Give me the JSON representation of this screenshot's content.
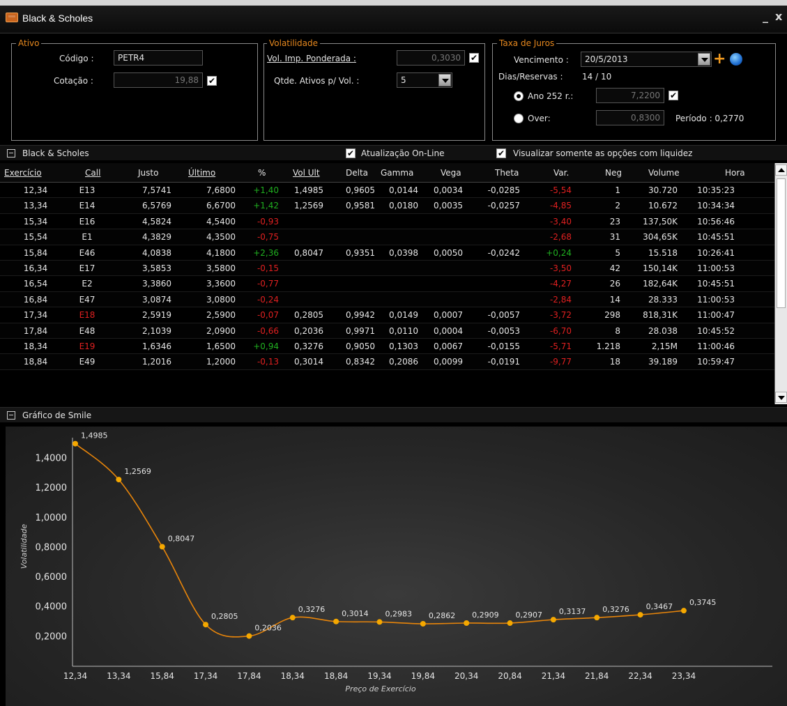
{
  "window": {
    "title": "Black & Scholes",
    "minimize": "_",
    "close": "x"
  },
  "ativo": {
    "legend": "Ativo",
    "codigo_label": "Código :",
    "codigo_value": "PETR4",
    "cotacao_label": "Cotação :",
    "cotacao_value": "19,88",
    "cotacao_checked": true
  },
  "volatilidade": {
    "legend": "Volatilidade",
    "vol_imp_label": "Vol. Imp. Ponderada :",
    "vol_imp_value": "0,3030",
    "vol_imp_checked": true,
    "qtde_label": "Qtde. Ativos p/ Vol. :",
    "qtde_value": "5"
  },
  "juros": {
    "legend": "Taxa de Juros",
    "vencimento_label": "Vencimento :",
    "vencimento_value": "20/5/2013",
    "dias_label": "Dias/Reservas :",
    "dias_value": "14 / 10",
    "ano_label": "Ano 252 r.:",
    "ano_value": "7,2200",
    "ano_checked": true,
    "over_label": "Over:",
    "over_value": "0,8300",
    "periodo_label": "Período : 0,2770"
  },
  "bs_section": {
    "title": "Black & Scholes",
    "online_label": "Atualização On-Line",
    "liquidez_label": "Visualizar somente as opções com liquidez"
  },
  "table": {
    "headers": [
      "Exercício",
      "Call",
      "Justo",
      "Último",
      "%",
      "Vol Ult",
      "Delta",
      "Gamma",
      "Vega",
      "Theta",
      "Var.",
      "Neg",
      "Volume",
      "Hora"
    ],
    "rows": [
      [
        "12,34",
        "E13",
        "7,5741",
        "7,6800",
        "+1,40",
        "1,4985",
        "0,9605",
        "0,0144",
        "0,0034",
        "-0,0285",
        "-5,54",
        "1",
        "30.720",
        "10:35:23"
      ],
      [
        "13,34",
        "E14",
        "6,5769",
        "6,6700",
        "+1,42",
        "1,2569",
        "0,9581",
        "0,0180",
        "0,0035",
        "-0,0257",
        "-4,85",
        "2",
        "10.672",
        "10:34:34"
      ],
      [
        "15,34",
        "E16",
        "4,5824",
        "4,5400",
        "-0,93",
        "",
        "",
        "",
        "",
        "",
        "-3,40",
        "23",
        "137,50K",
        "10:56:46"
      ],
      [
        "15,54",
        "E1",
        "4,3829",
        "4,3500",
        "-0,75",
        "",
        "",
        "",
        "",
        "",
        "-2,68",
        "31",
        "304,65K",
        "10:45:51"
      ],
      [
        "15,84",
        "E46",
        "4,0838",
        "4,1800",
        "+2,36",
        "0,8047",
        "0,9351",
        "0,0398",
        "0,0050",
        "-0,0242",
        "+0,24",
        "5",
        "15.518",
        "10:26:41"
      ],
      [
        "16,34",
        "E17",
        "3,5853",
        "3,5800",
        "-0,15",
        "",
        "",
        "",
        "",
        "",
        "-3,50",
        "42",
        "150,14K",
        "11:00:53"
      ],
      [
        "16,54",
        "E2",
        "3,3860",
        "3,3600",
        "-0,77",
        "",
        "",
        "",
        "",
        "",
        "-4,27",
        "26",
        "182,64K",
        "10:45:51"
      ],
      [
        "16,84",
        "E47",
        "3,0874",
        "3,0800",
        "-0,24",
        "",
        "",
        "",
        "",
        "",
        "-2,84",
        "14",
        "28.333",
        "11:00:53"
      ],
      [
        "17,34",
        "E18",
        "2,5919",
        "2,5900",
        "-0,07",
        "0,2805",
        "0,9942",
        "0,0149",
        "0,0007",
        "-0,0057",
        "-3,72",
        "298",
        "818,31K",
        "11:00:47"
      ],
      [
        "17,84",
        "E48",
        "2,1039",
        "2,0900",
        "-0,66",
        "0,2036",
        "0,9971",
        "0,0110",
        "0,0004",
        "-0,0053",
        "-6,70",
        "8",
        "28.038",
        "10:45:52"
      ],
      [
        "18,34",
        "E19",
        "1,6346",
        "1,6500",
        "+0,94",
        "0,3276",
        "0,9050",
        "0,1303",
        "0,0067",
        "-0,0155",
        "-5,71",
        "1.218",
        "2,15M",
        "11:00:46"
      ],
      [
        "18,84",
        "E49",
        "1,2016",
        "1,2000",
        "-0,13",
        "0,3014",
        "0,8342",
        "0,2086",
        "0,0099",
        "-0,0191",
        "-9,77",
        "18",
        "39.189",
        "10:59:47"
      ]
    ],
    "red_calls": [
      "E18",
      "E19"
    ]
  },
  "smile_section": {
    "title": "Gráfico de Smile"
  },
  "chart_data": {
    "type": "line",
    "xlabel": "Preço de Exercício",
    "ylabel": "Volatilidade",
    "categories": [
      "12,34",
      "13,34",
      "15,84",
      "17,34",
      "17,84",
      "18,34",
      "18,84",
      "19,34",
      "19,84",
      "20,34",
      "20,84",
      "21,34",
      "21,84",
      "22,34",
      "23,34"
    ],
    "values": [
      1.4985,
      1.2569,
      0.8047,
      0.2805,
      0.2036,
      0.3276,
      0.3014,
      0.2983,
      0.2862,
      0.2909,
      0.2907,
      0.3137,
      0.3276,
      0.3467,
      0.3745
    ],
    "value_labels": [
      "1,4985",
      "1,2569",
      "0,8047",
      "0,2805",
      "0,2036",
      "0,3276",
      "0,3014",
      "0,2983",
      "0,2862",
      "0,2909",
      "0,2907",
      "0,3137",
      "0,3276",
      "0,3467",
      "0,3745"
    ],
    "yticks": [
      "0,2000",
      "0,4000",
      "0,6000",
      "0,8000",
      "1,0000",
      "1,2000",
      "1,4000"
    ],
    "ytick_values": [
      0.2,
      0.4,
      0.6,
      0.8,
      1.0,
      1.2,
      1.4
    ],
    "ylim": [
      0.0,
      1.52
    ],
    "line_color": "#e8850a",
    "point_color": "#f5a800"
  }
}
